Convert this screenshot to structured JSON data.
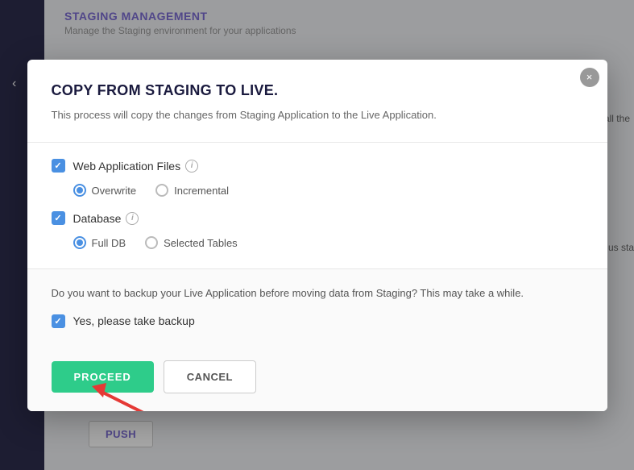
{
  "background": {
    "title": "STAGING MANAGEMENT",
    "subtitle": "Manage the Staging environment for your applications",
    "right_text1": "all the",
    "right_text2": "us sta",
    "push_button": "PUSH"
  },
  "modal": {
    "title": "COPY FROM STAGING TO LIVE.",
    "description": "This process will copy the changes from Staging Application to the Live Application.",
    "close_icon": "×",
    "web_app_files": {
      "label": "Web Application Files",
      "checked": true,
      "info": "i",
      "options": [
        {
          "label": "Overwrite",
          "selected": true
        },
        {
          "label": "Incremental",
          "selected": false
        }
      ]
    },
    "database": {
      "label": "Database",
      "checked": true,
      "info": "i",
      "options": [
        {
          "label": "Full DB",
          "selected": true
        },
        {
          "label": "Selected Tables",
          "selected": false
        }
      ]
    },
    "backup": {
      "description": "Do you want to backup your Live Application before moving data from Staging? This may take a while.",
      "checkbox_label": "Yes, please take backup",
      "checked": true
    },
    "buttons": {
      "proceed": "PROCEED",
      "cancel": "CANCEL"
    }
  }
}
